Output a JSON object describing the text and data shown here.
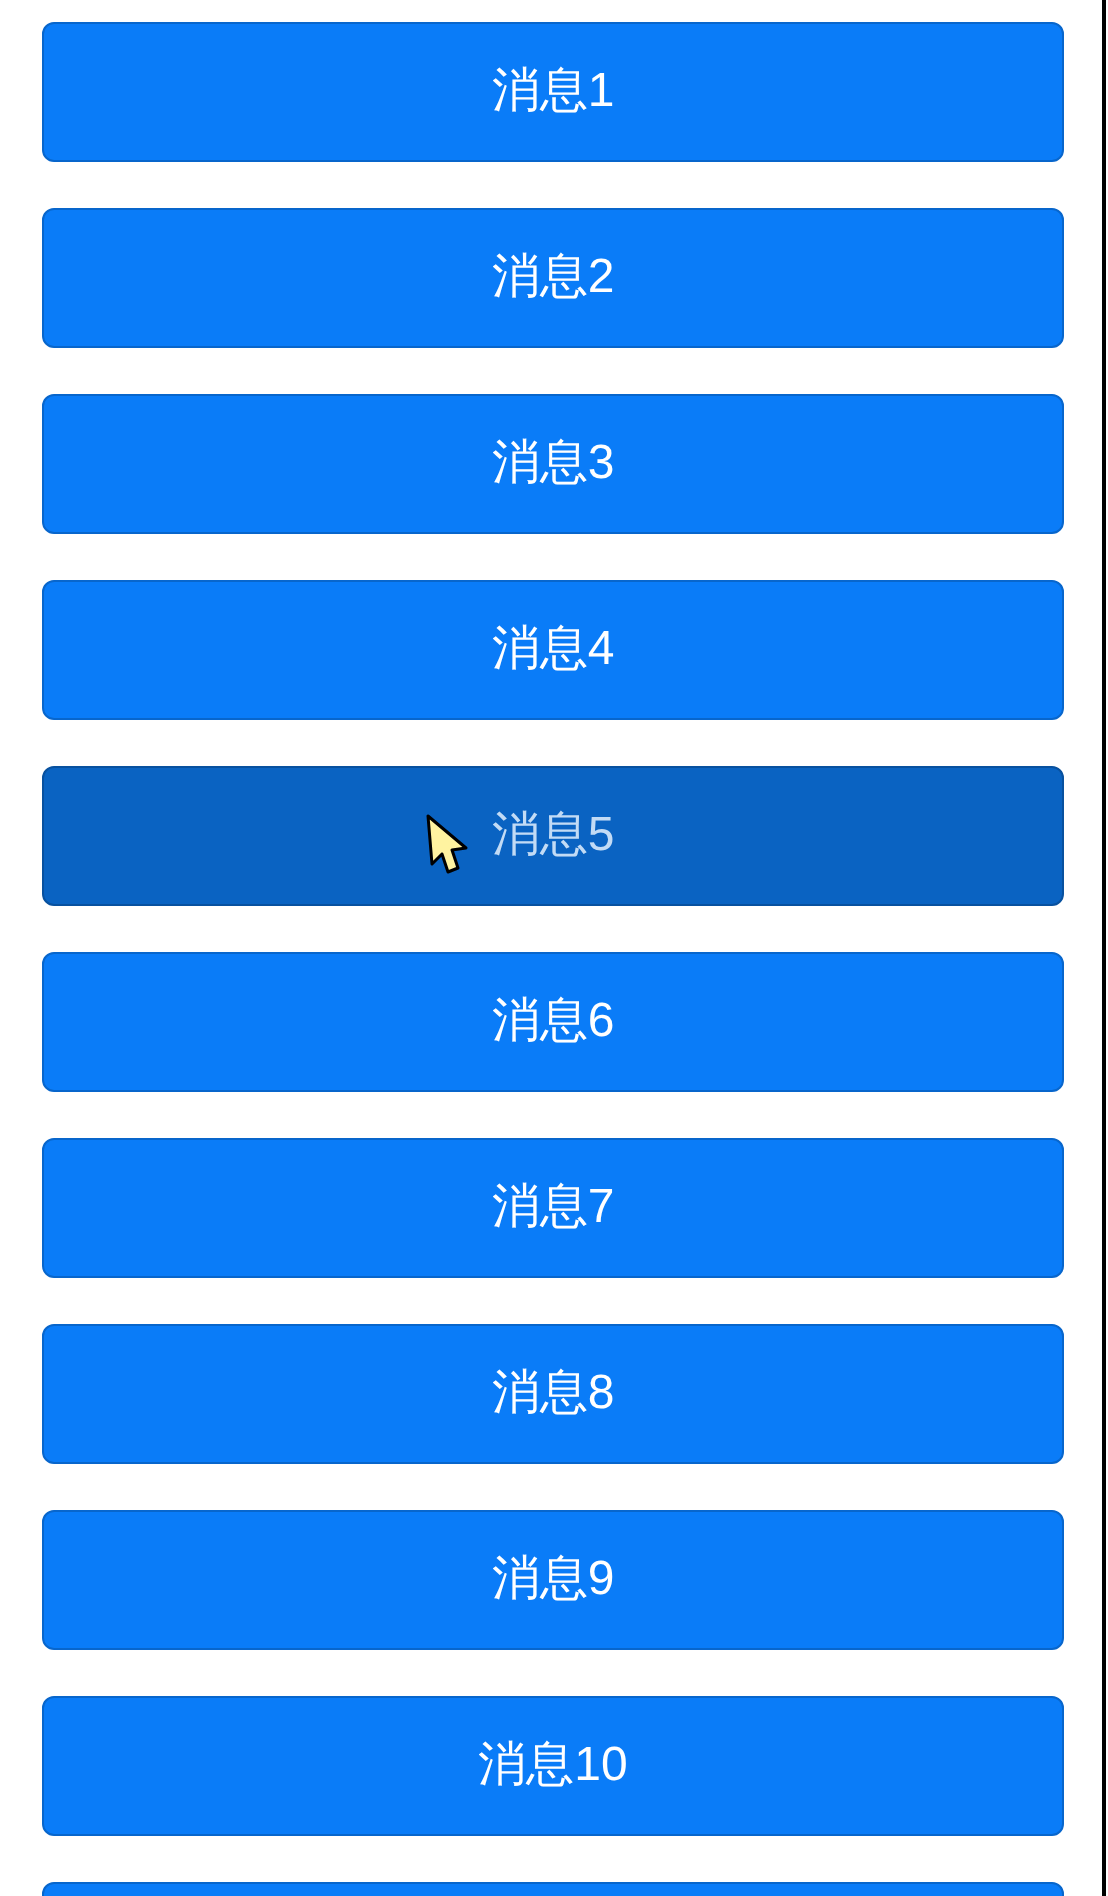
{
  "buttons": [
    {
      "label": "消息1",
      "pressed": false
    },
    {
      "label": "消息2",
      "pressed": false
    },
    {
      "label": "消息3",
      "pressed": false
    },
    {
      "label": "消息4",
      "pressed": false
    },
    {
      "label": "消息5",
      "pressed": true
    },
    {
      "label": "消息6",
      "pressed": false
    },
    {
      "label": "消息7",
      "pressed": false
    },
    {
      "label": "消息8",
      "pressed": false
    },
    {
      "label": "消息9",
      "pressed": false
    },
    {
      "label": "消息10",
      "pressed": false
    },
    {
      "pressed": false
    }
  ]
}
